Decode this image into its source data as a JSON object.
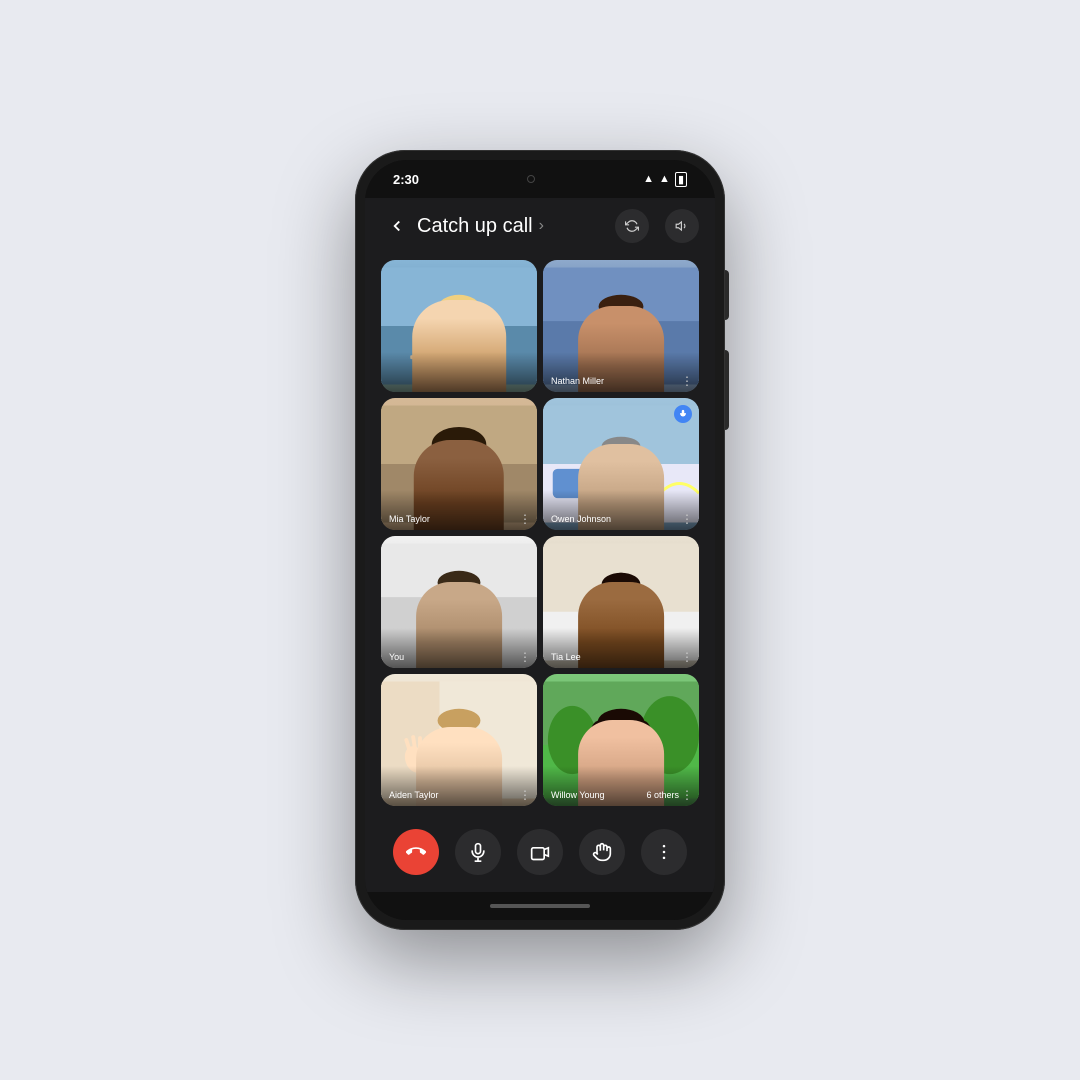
{
  "status_bar": {
    "time": "2:30",
    "camera_dot": "camera",
    "wifi_bars": "▲",
    "signal": "▲",
    "battery": "▮"
  },
  "top_bar": {
    "back_label": "←",
    "title": "Catch up call",
    "chevron": "›",
    "rotate_icon": "rotate",
    "audio_icon": "audio"
  },
  "participants": [
    {
      "id": "participant-1",
      "name": "",
      "face_class": "face-1",
      "has_badge": false,
      "badge_type": "",
      "others_count": ""
    },
    {
      "id": "participant-2",
      "name": "Nathan Miller",
      "face_class": "face-2",
      "has_badge": false,
      "badge_type": "",
      "others_count": ""
    },
    {
      "id": "participant-3",
      "name": "Mia Taylor",
      "face_class": "face-3",
      "has_badge": false,
      "badge_type": "",
      "others_count": ""
    },
    {
      "id": "participant-4",
      "name": "Owen Johnson",
      "face_class": "face-4",
      "has_badge": true,
      "badge_type": "audio",
      "others_count": ""
    },
    {
      "id": "participant-5",
      "name": "You",
      "face_class": "face-5",
      "has_badge": false,
      "badge_type": "",
      "others_count": ""
    },
    {
      "id": "participant-6",
      "name": "Tia Lee",
      "face_class": "face-6",
      "has_badge": false,
      "badge_type": "",
      "others_count": ""
    },
    {
      "id": "participant-7",
      "name": "Aiden Taylor",
      "face_class": "face-7",
      "has_badge": false,
      "badge_type": "",
      "others_count": ""
    },
    {
      "id": "participant-8",
      "name": "Willow Young",
      "face_class": "face-8",
      "has_badge": false,
      "badge_type": "",
      "others_count": "6 others"
    }
  ],
  "controls": {
    "end_call_label": "end",
    "mute_label": "mic",
    "camera_label": "camera",
    "raise_hand_label": "hand",
    "more_label": "more"
  },
  "colors": {
    "end_call_bg": "#ea4335",
    "control_bg": "#2c2c2e",
    "app_bg": "#1c1c1e",
    "phone_bg": "#1a1a1a",
    "badge_blue": "#4285f4"
  }
}
